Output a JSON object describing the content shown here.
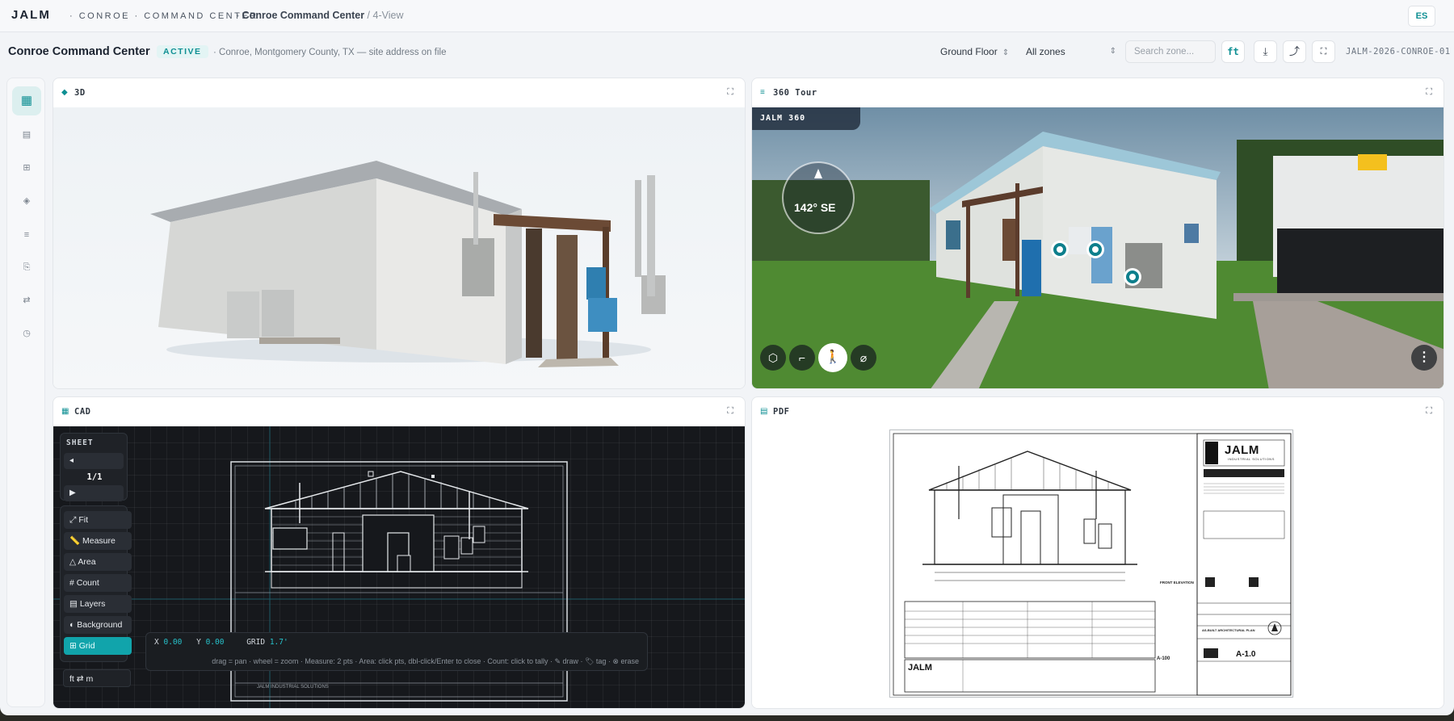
{
  "topbar": {
    "brand": "JALM",
    "brand_sub": "· CONROE · COMMAND CENTER",
    "crumb_sep": "›",
    "crumb_site": "Conroe Command Center",
    "crumb_view": "/ 4-View",
    "lang_button": "ES"
  },
  "header": {
    "site_title": "Conroe Command Center",
    "status_badge": "ACTIVE",
    "address": "· Conroe, Montgomery County, TX — site address on file",
    "floor_select": "Ground Floor",
    "zone_select": "All zones",
    "search_placeholder": "Search zone...",
    "unit_button": "ft",
    "project_id": "JALM-2026-CONROE-01"
  },
  "sidebar": {
    "items": [
      {
        "icon": "grid-view-icon",
        "glyph": "▦"
      },
      {
        "icon": "list-icon",
        "glyph": "▤"
      },
      {
        "icon": "plan-icon",
        "glyph": "⊞"
      },
      {
        "icon": "cube-icon",
        "glyph": "◈"
      },
      {
        "icon": "menu-icon",
        "glyph": "≡"
      },
      {
        "icon": "document-icon",
        "glyph": "⎘"
      },
      {
        "icon": "swap-icon",
        "glyph": "⇄"
      },
      {
        "icon": "clock-icon",
        "glyph": "◷"
      }
    ]
  },
  "panels": {
    "model": {
      "title": "3D"
    },
    "tour": {
      "title": "360 Tour",
      "overlay_brand": "JALM 360",
      "compass": "142° SE"
    },
    "cad": {
      "title": "CAD",
      "sheet_label": "SHEET",
      "sheet_prev": "◂",
      "sheet_page": "1/1",
      "sheet_next": "▶",
      "tools": [
        "⤢ Fit",
        "📏 Measure",
        "△ Area",
        "# Count",
        "▤ Layers",
        "◐ Background",
        "⊞ Grid",
        "ft ⇄ m"
      ],
      "coord_x_label": "X",
      "coord_x": "0.00",
      "coord_y_label": "Y",
      "coord_y": "0.00",
      "grid_label": "GRID",
      "grid_value": "1.7'",
      "hint": "drag = pan · wheel = zoom · Measure: 2 pts · Area: click pts, dbl-click/Enter to close · Count: click to tally · ✎ draw · 🏷 tag · ⊗ erase",
      "drawing_footer": "JALM INDUSTRIAL SOLUTIONS"
    },
    "pdf": {
      "title": "PDF",
      "tb_logo": "JALM",
      "tb_logo_sub": "INDUSTRIAL SOLUTIONS",
      "tb_sheet_no": "A-1.0",
      "tb_sheet_ref": "A-100",
      "tb_front": "FRONT ELEVATION",
      "tb_plan": "AS-BUILT ARCHITECTURAL PLAN",
      "footer_logo": "JALM"
    }
  },
  "colors": {
    "accent": "#0e8f93",
    "cad_bg": "#16181c",
    "grid_active": "#11a4ab"
  }
}
